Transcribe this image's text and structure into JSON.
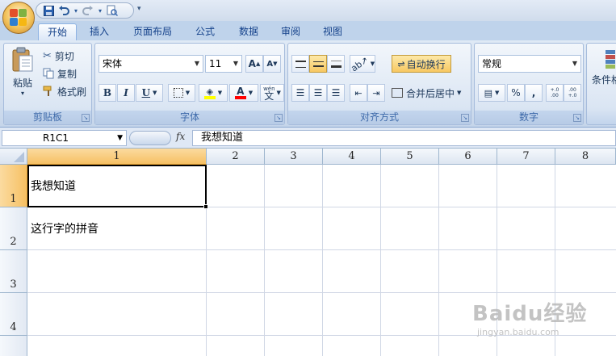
{
  "qat": {
    "dropdown_glyph": "▾"
  },
  "tabs": [
    "开始",
    "插入",
    "页面布局",
    "公式",
    "数据",
    "审阅",
    "视图"
  ],
  "clipboard": {
    "paste_label": "粘贴",
    "cut_label": "剪切",
    "copy_label": "复制",
    "format_painter_label": "格式刷",
    "group_label": "剪贴板"
  },
  "font": {
    "font_name": "宋体",
    "font_size": "11",
    "grow": "A",
    "shrink": "A",
    "bold": "B",
    "italic": "I",
    "underline": "U",
    "font_color_glyph": "A",
    "phonetic_glyph": "wén",
    "phonetic_char": "文",
    "group_label": "字体"
  },
  "alignment": {
    "wrap_text_label": "自动换行",
    "merge_center_label": "合并后居中",
    "group_label": "对齐方式"
  },
  "number": {
    "format_value": "常规",
    "percent": "%",
    "comma": ",",
    "inc_decimal": "+.0 .00",
    "dec_decimal": ".00 +.0",
    "group_label": "数字"
  },
  "styles": {
    "conditional_label": "条件格"
  },
  "formula_bar": {
    "name_box": "R1C1",
    "fx_label": "fx",
    "content": "我想知道"
  },
  "grid": {
    "columns": [
      "1",
      "2",
      "3",
      "4",
      "5",
      "6",
      "7",
      "8"
    ],
    "rows": [
      "1",
      "2",
      "3",
      "4"
    ],
    "cells": {
      "r1c1": "我想知道",
      "r2c1": "这行字的拼音"
    }
  },
  "watermark": {
    "main": "Baidu经验",
    "sub": "jingyan.baidu.com"
  },
  "colors": {
    "accent": "#15428b",
    "fill_highlight": "#ffff00",
    "font_color": "#ff0000"
  }
}
